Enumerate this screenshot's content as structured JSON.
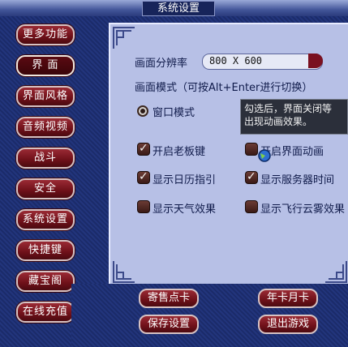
{
  "window": {
    "title": "系统设置"
  },
  "sidebar": {
    "items": [
      {
        "label": "更多功能",
        "active": false
      },
      {
        "label": "界 面",
        "active": true
      },
      {
        "label": "界面风格",
        "active": false
      },
      {
        "label": "音频视频",
        "active": false
      },
      {
        "label": "战斗",
        "active": false
      },
      {
        "label": "安全",
        "active": false
      },
      {
        "label": "系统设置",
        "active": false
      },
      {
        "label": "快捷键",
        "active": false
      },
      {
        "label": "藏宝阁",
        "active": false
      },
      {
        "label": "在线充值",
        "active": false
      }
    ]
  },
  "panel": {
    "resolution_label": "画面分辨率",
    "resolution_value": "800 X 600",
    "mode_label": "画面模式（可按Alt+Enter进行切换）",
    "window_mode_label": "窗口模式",
    "window_mode_selected": true,
    "tooltip_line1": "勾选后，界面关闭等",
    "tooltip_line2": "出现动画效果。",
    "checkboxes": [
      {
        "label": "开启老板键",
        "checked": true
      },
      {
        "label": "开启界面动画",
        "checked": false
      },
      {
        "label": "显示日历指引",
        "checked": true
      },
      {
        "label": "显示服务器时间",
        "checked": true
      },
      {
        "label": "显示天气效果",
        "checked": false
      },
      {
        "label": "显示飞行云雾效果",
        "checked": false
      }
    ]
  },
  "footer": {
    "sell_points_card": "寄售点卡",
    "year_month_card": "年卡月卡",
    "save_settings": "保存设置",
    "exit_game": "退出游戏"
  },
  "colors": {
    "accent": "#7a1020",
    "panel": "#b7c0e6",
    "frame": "#1d2f72"
  }
}
